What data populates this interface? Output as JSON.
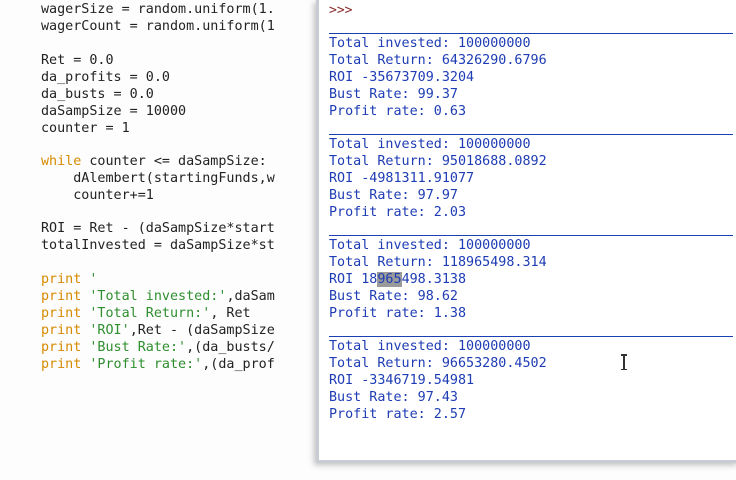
{
  "editor": {
    "lines": [
      {
        "t": "wagerSize = random.uniform(1."
      },
      {
        "t": "wagerCount = random.uniform(1"
      },
      {
        "t": ""
      },
      {
        "t": "Ret = 0.0"
      },
      {
        "t": "da_profits = 0.0"
      },
      {
        "t": "da_busts = 0.0"
      },
      {
        "t": "daSampSize = 10000"
      },
      {
        "t": "counter = 1"
      },
      {
        "t": ""
      },
      {
        "kw": "while",
        "rest": " counter <= daSampSize:"
      },
      {
        "t": "    dAlembert(startingFunds,w"
      },
      {
        "t": "    counter+=1"
      },
      {
        "t": ""
      },
      {
        "t": "ROI = Ret - (daSampSize*start"
      },
      {
        "t": "totalInvested = daSampSize*st"
      },
      {
        "t": ""
      },
      {
        "kw": "print",
        "str": " '"
      },
      {
        "kw": "print",
        "str": " 'Total invested:'",
        "rest": ",daSam"
      },
      {
        "kw": "print",
        "str": " 'Total Return:'",
        "rest": ", Ret"
      },
      {
        "kw": "print",
        "str": " 'ROI'",
        "rest": ",Ret - (daSampSize"
      },
      {
        "kw": "print",
        "str": " 'Bust Rate:'",
        "rest": ",(da_busts/"
      },
      {
        "kw": "print",
        "str": " 'Profit rate:'",
        "rest": ",(da_prof"
      }
    ]
  },
  "shell": {
    "prompt": ">>>",
    "blocks": [
      {
        "invested": "Total invested: 100000000",
        "ret": "Total Return: 64326290.6796",
        "roi": "ROI -35673709.3204",
        "bust": "Bust Rate: 99.37",
        "profit": "Profit rate: 0.63"
      },
      {
        "invested": "Total invested: 100000000",
        "ret": "Total Return: 95018688.0892",
        "roi": "ROI -4981311.91077",
        "bust": "Bust Rate: 97.97",
        "profit": "Profit rate: 2.03"
      },
      {
        "invested": "Total invested: 100000000",
        "ret": "Total Return: 118965498.314",
        "roi_pre": "ROI 18",
        "roi_sel": "965",
        "roi_post": "498.3138",
        "bust": "Bust Rate: 98.62",
        "profit": "Profit rate: 1.38"
      },
      {
        "invested": "Total invested: 100000000",
        "ret": "Total Return: 96653280.4502",
        "roi": "ROI -3346719.54981",
        "bust": "Bust Rate: 97.43",
        "profit": "Profit rate: 2.57"
      }
    ]
  }
}
